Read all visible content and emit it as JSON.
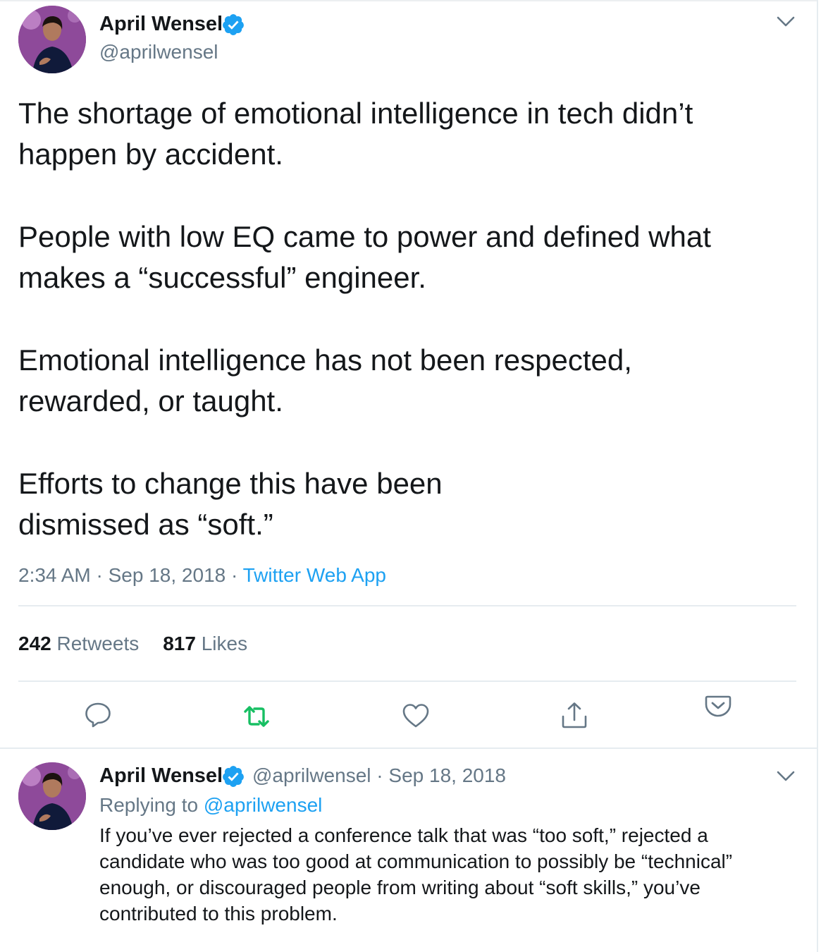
{
  "main_tweet": {
    "author_name": "April Wensel",
    "author_handle": "@aprilwensel",
    "body_lines": [
      "The shortage of emotional intelligence in tech didn’t",
      "happen by accident.",
      "People with low EQ came to power and defined what",
      "makes a “successful” engineer.",
      "Emotional intelligence has not been respected,",
      "rewarded, or taught.",
      "Efforts to change this have been",
      "dismissed as “soft.”"
    ],
    "time": "2:34 AM",
    "date": "Sep 18, 2018",
    "source": "Twitter Web App",
    "retweet_count": "242",
    "retweets_label": "Retweets",
    "like_count": "817",
    "likes_label": "Likes"
  },
  "reply_tweet": {
    "author_name": "April Wensel",
    "author_handle": "@aprilwensel",
    "date": "Sep 18, 2018",
    "replying_prefix": "Replying to",
    "replying_handle": "@aprilwensel",
    "body_lines": [
      "If you’ve ever rejected a conference talk that was “too soft,” rejected a",
      "candidate who was too good at communication to possibly be “technical”",
      "enough, or discouraged people from writing about “soft skills,” you’ve",
      "contributed to this problem."
    ]
  },
  "separators": {
    "meta_dot": "·",
    "handle_dot": "·"
  },
  "icons": [
    "verified-badge-icon",
    "chevron-down-icon",
    "reply-icon",
    "retweet-icon",
    "like-icon",
    "share-icon",
    "pocket-icon"
  ],
  "colors": {
    "link": "#1da1f2",
    "secondary_text": "#657786",
    "primary_text": "#14171a",
    "retweet_green": "#17bf63",
    "divider": "#e6ecf0"
  }
}
